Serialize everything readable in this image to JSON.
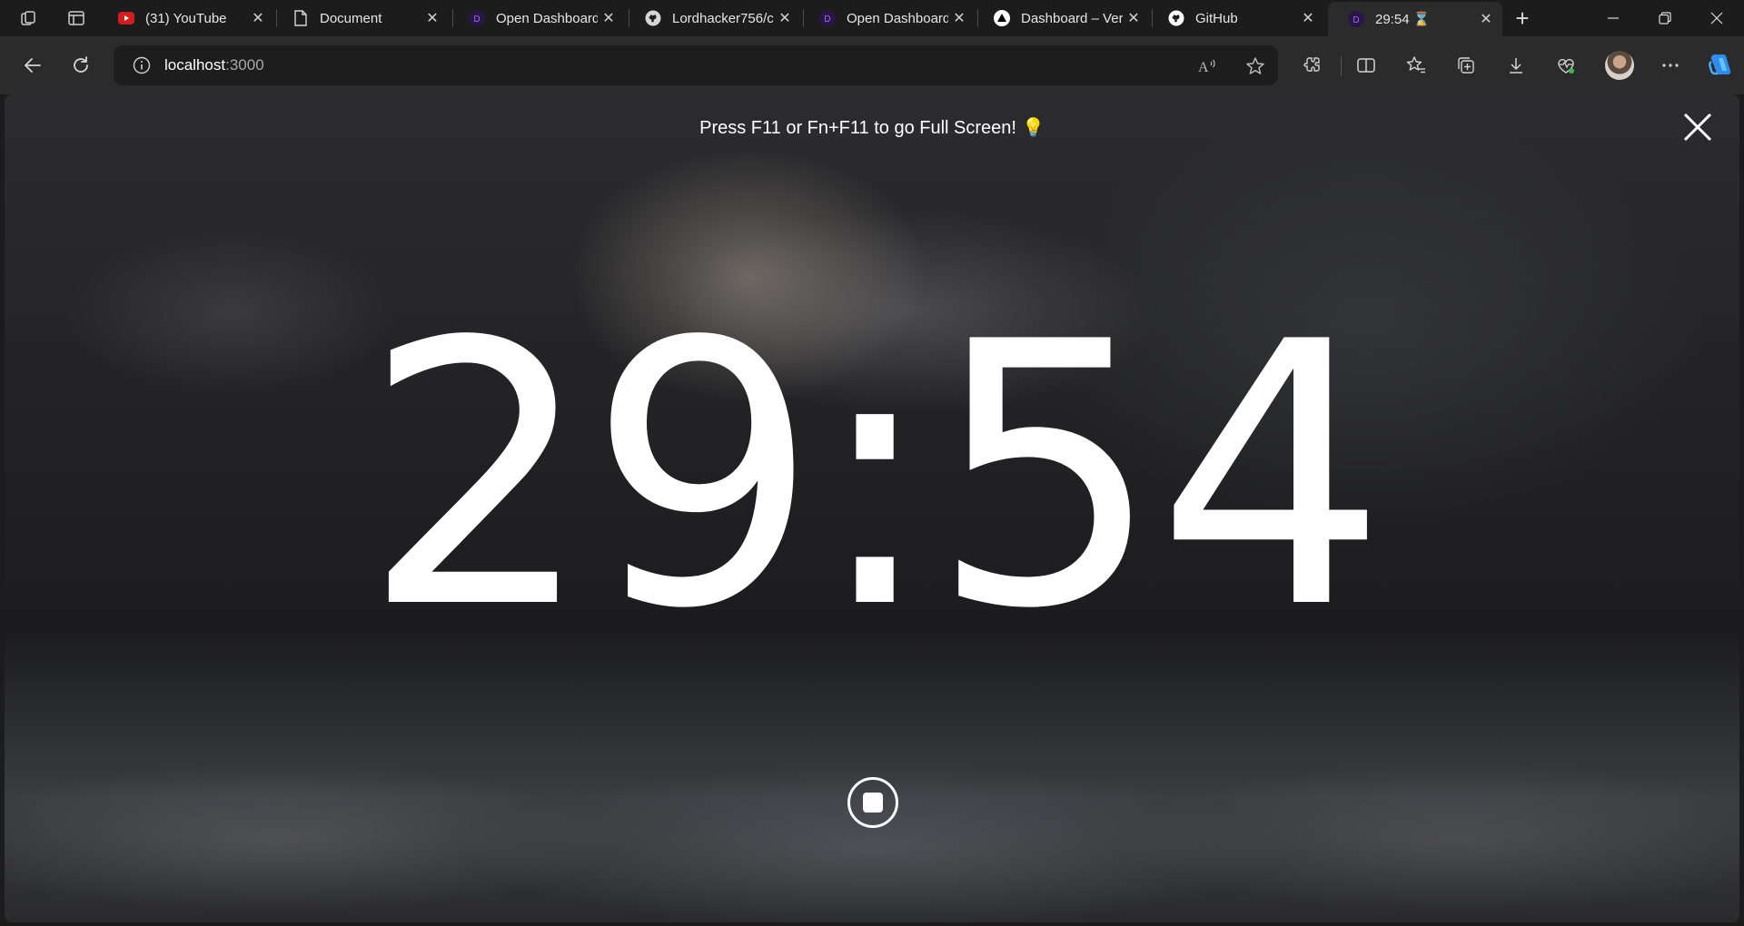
{
  "browser": {
    "tabs": [
      {
        "title": "(31) YouTube",
        "icon": "youtube-icon"
      },
      {
        "title": "Document",
        "icon": "document-icon"
      },
      {
        "title": "Open Dashboard",
        "icon": "dashboard-app-icon"
      },
      {
        "title": "Lordhacker756/c",
        "icon": "github-icon"
      },
      {
        "title": "Open Dashboard",
        "icon": "dashboard-app-icon"
      },
      {
        "title": "Dashboard – Ver",
        "icon": "vercel-icon"
      },
      {
        "title": "GitHub",
        "icon": "github-icon"
      },
      {
        "title": "29:54 ⌛",
        "icon": "dashboard-app-icon",
        "active": true
      }
    ],
    "address": {
      "host": "localhost",
      "port": ":3000"
    },
    "colors": {
      "youtube_red": "#d21d1d",
      "dashboard_purple": "#2a1646",
      "copilot_blue": "#2f8cf0"
    }
  },
  "page": {
    "fullscreen_hint": "Press F11 or Fn+F11 to go Full Screen!",
    "hint_emoji": "💡",
    "timer": "29:54",
    "close_label": "close-icon",
    "stop_label": "stop-icon"
  }
}
